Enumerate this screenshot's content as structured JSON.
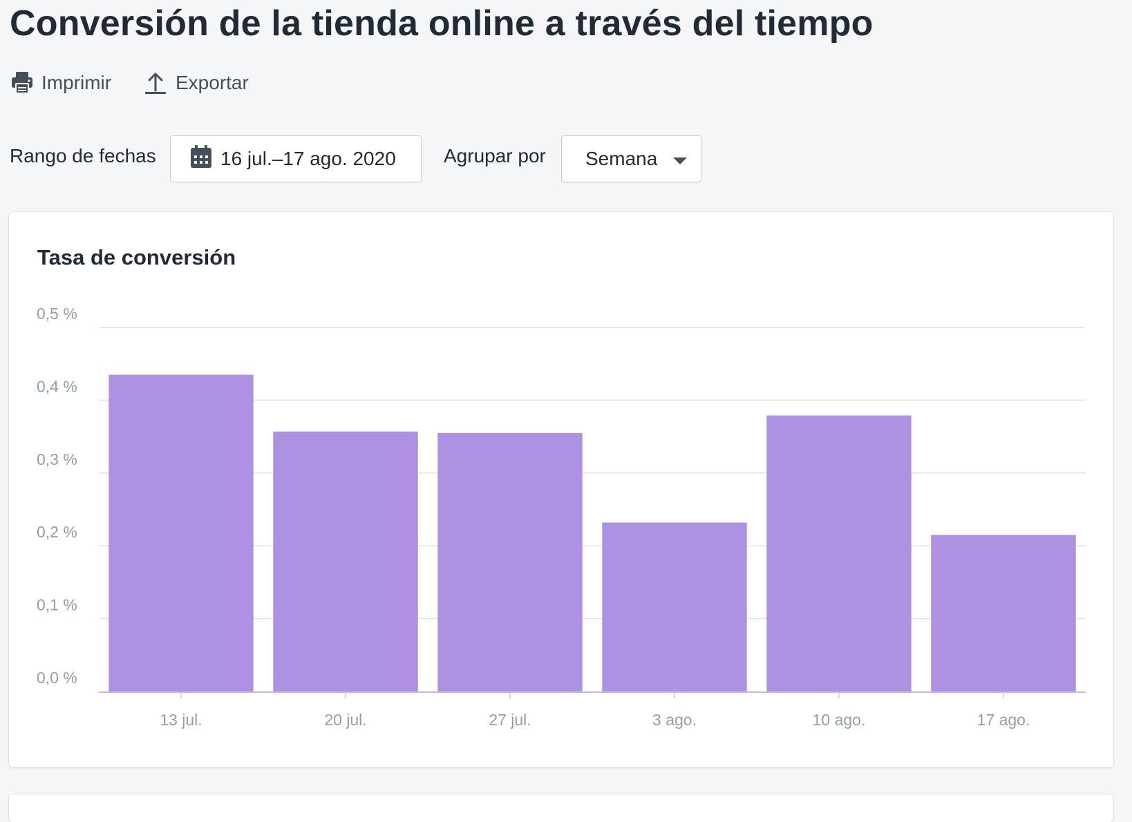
{
  "page": {
    "title": "Conversión de la tienda online a través del tiempo"
  },
  "actions": {
    "print_label": "Imprimir",
    "export_label": "Exportar"
  },
  "filters": {
    "date_range_label": "Rango de fechas",
    "date_range_value": "16 jul.–17 ago. 2020",
    "group_by_label": "Agrupar por",
    "group_by_value": "Semana"
  },
  "icons": {
    "print": "printer-icon",
    "export": "upload-icon",
    "calendar": "calendar-icon",
    "dropdown": "caret-down-icon"
  },
  "colors": {
    "bar": "#ae91e2",
    "text_primary": "#212b36",
    "text_secondary": "#919eab",
    "grid": "#dfe3e8"
  },
  "chart_data": {
    "type": "bar",
    "title": "Tasa de conversión",
    "categories": [
      "13 jul.",
      "20 jul.",
      "27 jul.",
      "3 ago.",
      "10 ago.",
      "17 ago."
    ],
    "values": [
      0.435,
      0.357,
      0.355,
      0.232,
      0.379,
      0.215
    ],
    "yticks": [
      "0,0 %",
      "0,1 %",
      "0,2 %",
      "0,3 %",
      "0,4 %",
      "0,5 %"
    ],
    "ytick_values": [
      0,
      0.1,
      0.2,
      0.3,
      0.4,
      0.5
    ],
    "ylim": [
      0,
      0.5
    ],
    "grid": true,
    "unit": "%"
  }
}
